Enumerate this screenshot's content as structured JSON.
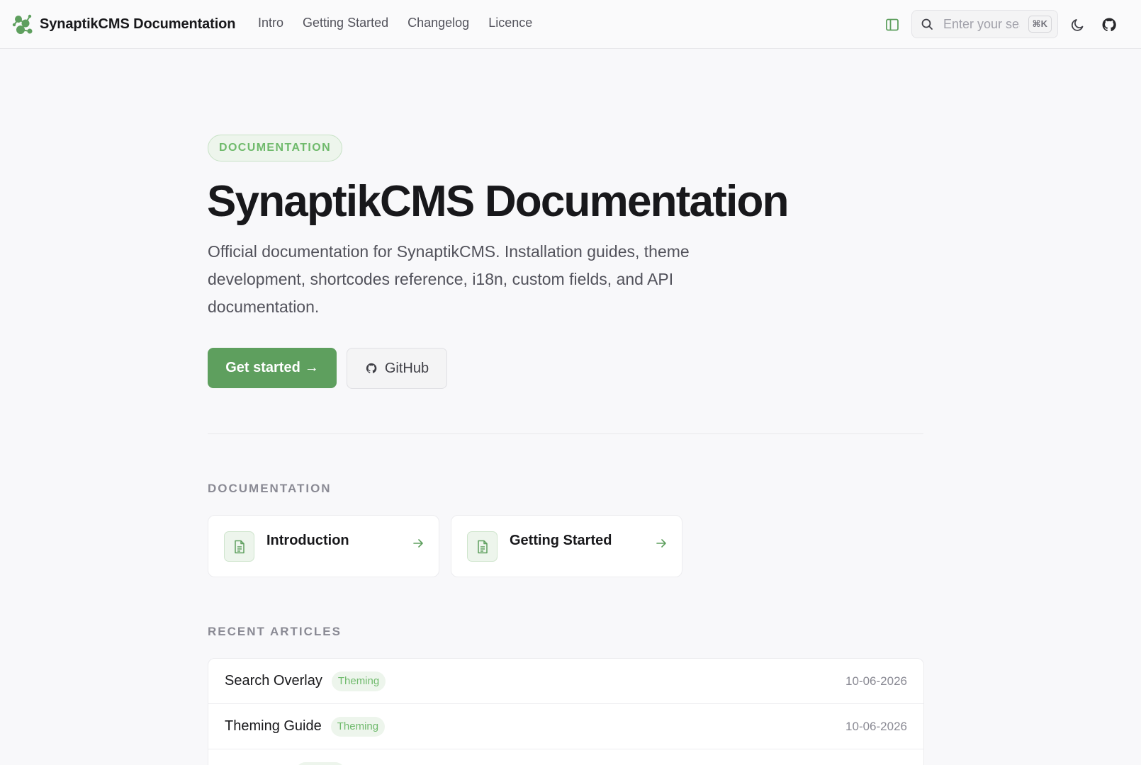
{
  "header": {
    "brand_name": "SynaptikCMS Documentation",
    "nav": [
      "Intro",
      "Getting Started",
      "Changelog",
      "Licence"
    ],
    "search_placeholder": "Enter your search",
    "search_shortcut": "⌘K",
    "accent_color": "#5e9f5e"
  },
  "hero": {
    "badge": "DOCUMENTATION",
    "title": "SynaptikCMS Documentation",
    "description": "Official documentation for SynaptikCMS. Installation guides, theme development, shortcodes reference, i18n, custom fields, and API documentation.",
    "primary_button": "Get started",
    "primary_button_arrow": "→",
    "secondary_button": "GitHub"
  },
  "documentation": {
    "label": "DOCUMENTATION",
    "cards": [
      {
        "title": "Introduction"
      },
      {
        "title": "Getting Started"
      }
    ]
  },
  "recent": {
    "label": "RECENT ARTICLES",
    "articles": [
      {
        "title": "Search Overlay",
        "tag": "Theming",
        "date": "10-06-2026"
      },
      {
        "title": "Theming Guide",
        "tag": "Theming",
        "date": "10-06-2026"
      }
    ]
  }
}
